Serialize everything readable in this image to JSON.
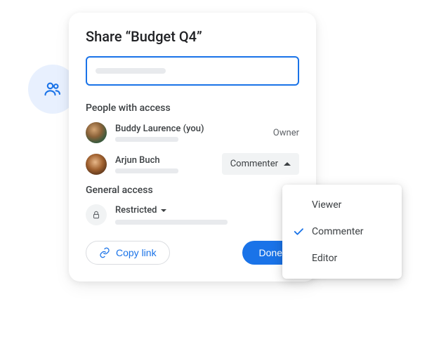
{
  "dialog": {
    "title": "Share “Budget Q4”",
    "people_heading": "People with access",
    "people": [
      {
        "name": "Buddy Laurence (you)",
        "role": "Owner"
      },
      {
        "name": "Arjun Buch",
        "role": "Commenter"
      }
    ],
    "general_heading": "General access",
    "general_access": {
      "label": "Restricted"
    },
    "footer": {
      "copy_link": "Copy link",
      "done": "Done"
    }
  },
  "dropdown": {
    "options": [
      {
        "label": "Viewer",
        "selected": false
      },
      {
        "label": "Commenter",
        "selected": true
      },
      {
        "label": "Editor",
        "selected": false
      }
    ]
  }
}
